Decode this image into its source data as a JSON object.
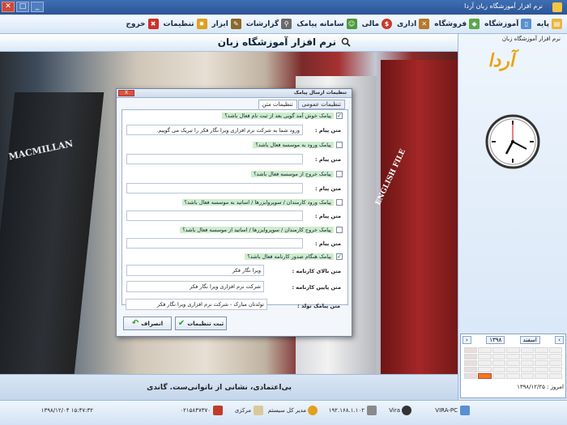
{
  "titlebar": {
    "title": "نرم افزار آموزشگاه زبان آردا"
  },
  "menu": {
    "items": [
      {
        "label": "پایه",
        "icon": "folder-icon",
        "color": "#e9b641"
      },
      {
        "label": "آموزشگاه",
        "icon": "book-icon",
        "color": "#5a8fd0"
      },
      {
        "label": "فروشگاه",
        "icon": "cart-icon",
        "color": "#5aa84a"
      },
      {
        "label": "اداری",
        "icon": "tools-icon",
        "color": "#b57a2a"
      },
      {
        "label": "مالی",
        "icon": "money-icon",
        "color": "#c23b2a"
      },
      {
        "label": "سامانه پیامک",
        "icon": "sms-icon",
        "color": "#4a9a3a"
      },
      {
        "label": "گزارشات",
        "icon": "search-icon",
        "color": "#6a6a6a"
      },
      {
        "label": "ابزار",
        "icon": "wrench-icon",
        "color": "#8a6a2a"
      },
      {
        "label": "تنظیمات",
        "icon": "gear-icon",
        "color": "#e0a020"
      },
      {
        "label": "خروج",
        "icon": "exit-icon",
        "color": "#d0302a"
      }
    ]
  },
  "header": {
    "title": "نرم افزار آموزشگاه زبان"
  },
  "rightpanel": {
    "caption": "نرم افزار آموزشگاه زبان",
    "logo": "آردا",
    "today": "امروز : ۱۳۹۸/۱۲/۲۵"
  },
  "calendar": {
    "month": "اسفند",
    "year": "۱۳۹۸"
  },
  "photo": {
    "text_left": "MACMILLAN",
    "text_right": "ENGLISH FILE"
  },
  "quote": "بی‌اعتمادی، نشانی از ناتوانی‌ست. گاندی",
  "status": {
    "time": "۱۵:۴۷:۳۲ ۱۳۹۸/۱۲/۰۴",
    "phone": "۰۲۱۵۸۴۷۳۷۰",
    "branch": "مرکزی",
    "user": "مدیر کل سیستم",
    "ip": "۱۹۲.۱۶۸.۱.۱۰۲",
    "vira": "Vira",
    "pc": "VIRA-PC"
  },
  "dialog": {
    "title": "تنظیمات ارسال پیامک",
    "close": "X",
    "tabs": [
      "تنظیمات عمومی",
      "تنظیمات متن"
    ],
    "checks": [
      {
        "label": "پیامک خوش آمد گویی بعد از ثبت نام فعال باشد؟",
        "checked": "✓"
      },
      {
        "label": "پیامک ورود به موسسه فعال باشد؟",
        "checked": ""
      },
      {
        "label": "پیامک خروج از موسسه فعال باشد؟",
        "checked": ""
      },
      {
        "label": "پیامک ورود کارمندان / سوپروایزرها / اساتید به موسسه فعال باشد؟",
        "checked": ""
      },
      {
        "label": "پیامک خروج کارمندان / سوپروایزرها / اساتید از موسسه فعال باشد؟",
        "checked": ""
      },
      {
        "label": "پیامک هنگام صدور کارنامه فعال باشد؟",
        "checked": "✓"
      }
    ],
    "msg_label": "متن پیام :",
    "msg1": "ورود شما به شرکت نرم افزاری ویرا نگار فکر را تبریک می گوییم.",
    "report_top_label": "متن بالای کارنامه :",
    "report_top": "ویرا نگار فکر",
    "report_bottom_label": "متن پایین کارنامه :",
    "report_bottom": "شرکت نرم افزاری ویرا نگار فکر",
    "birthday_label": "متن پیامک تولد :",
    "birthday": "تولدتان مبارک - شرکت نرم افزاری ویرا نگار فکر",
    "save": "ثبت تنظیمات",
    "cancel": "انصراف"
  }
}
